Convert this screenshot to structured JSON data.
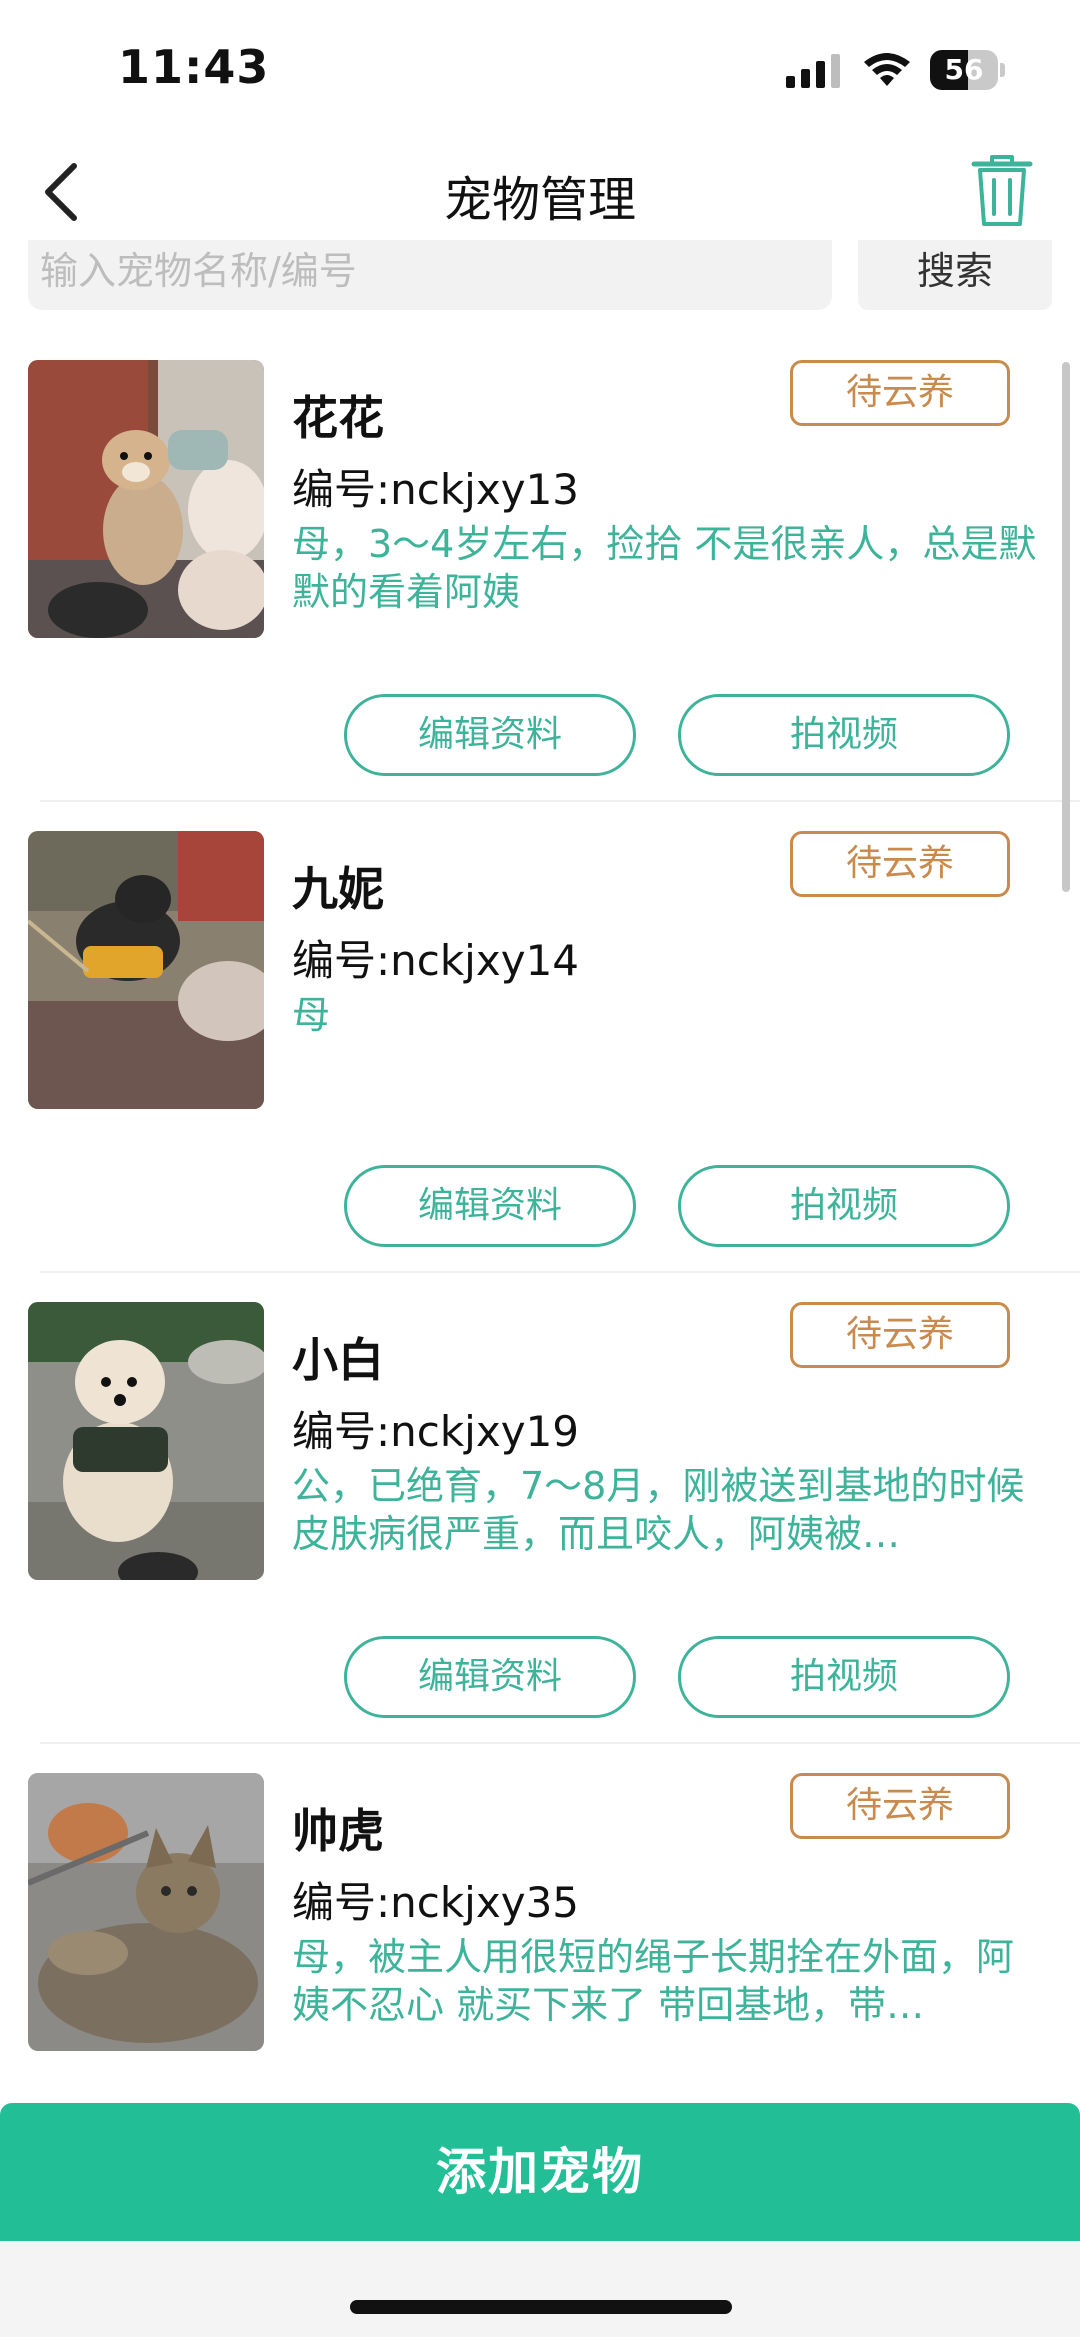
{
  "status_bar": {
    "time": "11:43",
    "battery": "56",
    "battery_level": 0.56
  },
  "nav": {
    "title": "宠物管理",
    "back_icon": "chevron-left-icon",
    "trash_icon": "trash-icon"
  },
  "search": {
    "placeholder": "输入宠物名称/编号",
    "button_label": "搜索"
  },
  "pets": [
    {
      "name": "花花",
      "id": "编号:nckjxy13",
      "description": "母，3～4岁左右，捡拾 不是很亲人，总是默默的看着阿姨",
      "status": "待云养",
      "edit_label": "编辑资料",
      "video_label": "拍视频"
    },
    {
      "name": "九妮",
      "id": "编号:nckjxy14",
      "description": "母",
      "status": "待云养",
      "edit_label": "编辑资料",
      "video_label": "拍视频"
    },
    {
      "name": "小白",
      "id": "编号:nckjxy19",
      "description": "公，已绝育，7～8月，刚被送到基地的时候皮肤病很严重，而且咬人，阿姨被…",
      "status": "待云养",
      "edit_label": "编辑资料",
      "video_label": "拍视频"
    },
    {
      "name": "帅虎",
      "id": "编号:nckjxy35",
      "description": "母，被主人用很短的绳子长期拴在外面，阿姨不忍心 就买下来了 带回基地，带…",
      "status": "待云养",
      "edit_label": "编辑资料",
      "video_label": "拍视频"
    }
  ],
  "bottom": {
    "add_button_label": "添加宠物"
  },
  "colors": {
    "accent": "#22bf97",
    "desc_text": "#3db39a",
    "badge": "#c98a4e"
  }
}
